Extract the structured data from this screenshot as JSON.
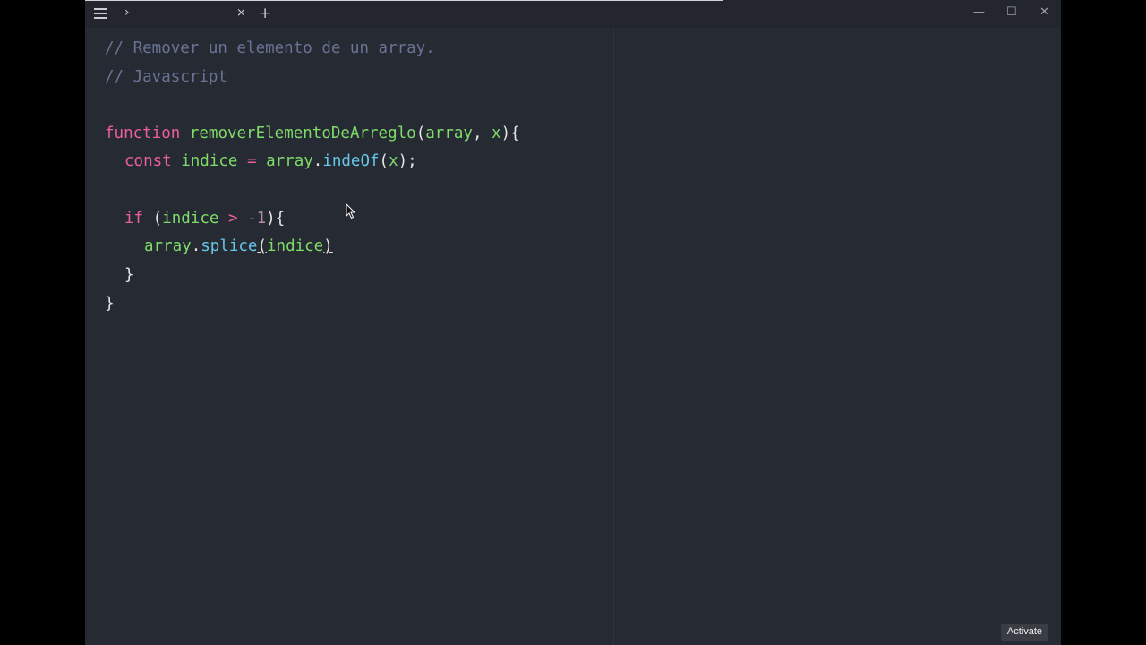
{
  "titlebar": {
    "tab_chevron": "›",
    "tab_close": "×",
    "new_tab": "+",
    "minimize": "—",
    "maximize": "☐",
    "close": "✕",
    "icons": [
      "hamburger-menu-icon",
      "chevron-right-icon",
      "close-icon",
      "plus-icon",
      "minimize-icon",
      "maximize-icon",
      "close-icon"
    ]
  },
  "code": {
    "line1": "// Remover un elemento de un array.",
    "line2": "// Javascript",
    "line4": {
      "kw": "function",
      "fn": "removerElementoDeArreglo",
      "p1": "(",
      "a1": "array",
      "p2": ", ",
      "a2": "x",
      "p3": "){"
    },
    "line5": {
      "kw": "const",
      "var": "indice",
      "eq": "=",
      "obj": "array",
      "dot": ".",
      "method": "indeOf",
      "open": "(",
      "arg": "x",
      "close": ");"
    },
    "line7": {
      "kw": "if",
      "open": "(",
      "var": "indice",
      "op": ">",
      "num": "-1",
      "close": "){"
    },
    "line8": {
      "obj": "array",
      "dot": ".",
      "method": "splice",
      "open": "(",
      "arg": "indice",
      "close": ")"
    },
    "line9": "}",
    "line10": "}"
  },
  "footer": {
    "activate_label": "Activate"
  },
  "colors": {
    "background": "#262a33",
    "titlebar": "#23262e",
    "comment": "#6b7394",
    "keyword": "#ec5f9b",
    "function": "#7fdb6a",
    "method": "#67c7e6"
  }
}
